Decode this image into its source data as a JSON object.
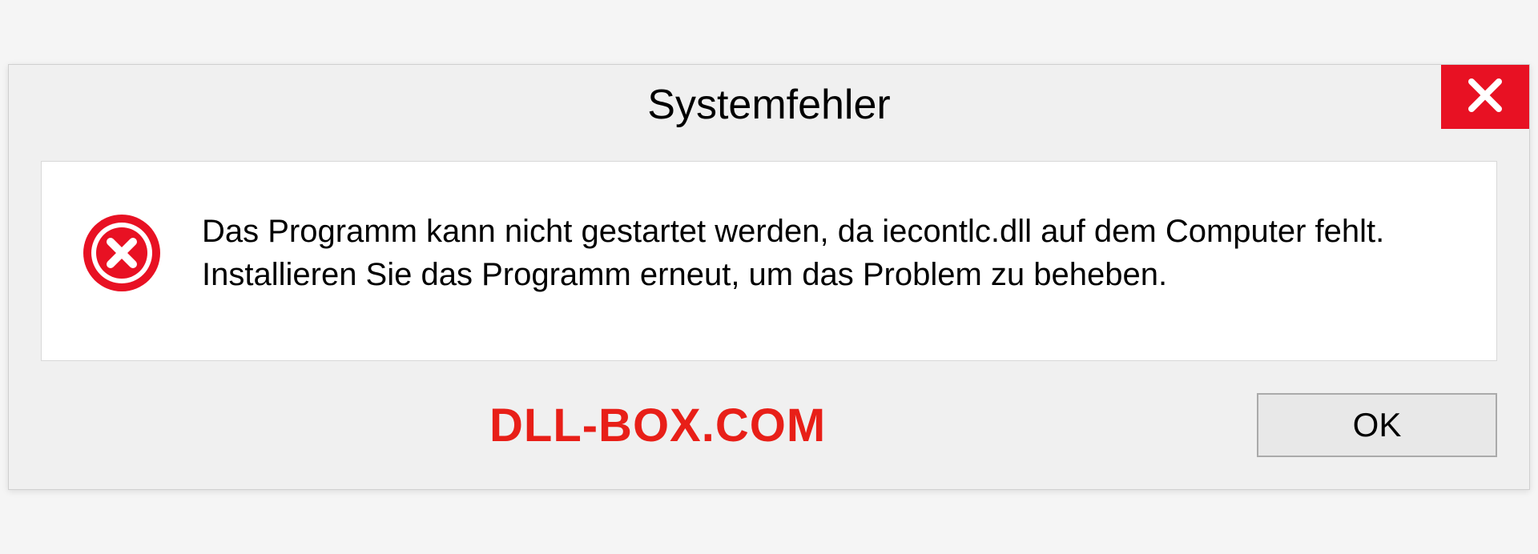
{
  "dialog": {
    "title": "Systemfehler",
    "message": "Das Programm kann nicht gestartet werden, da iecontlc.dll auf dem Computer fehlt. Installieren Sie das Programm erneut, um das Problem zu beheben.",
    "ok_label": "OK"
  },
  "watermark": "DLL-BOX.COM",
  "colors": {
    "close_bg": "#e81123",
    "error_icon": "#e81123",
    "watermark": "#e81f18"
  }
}
